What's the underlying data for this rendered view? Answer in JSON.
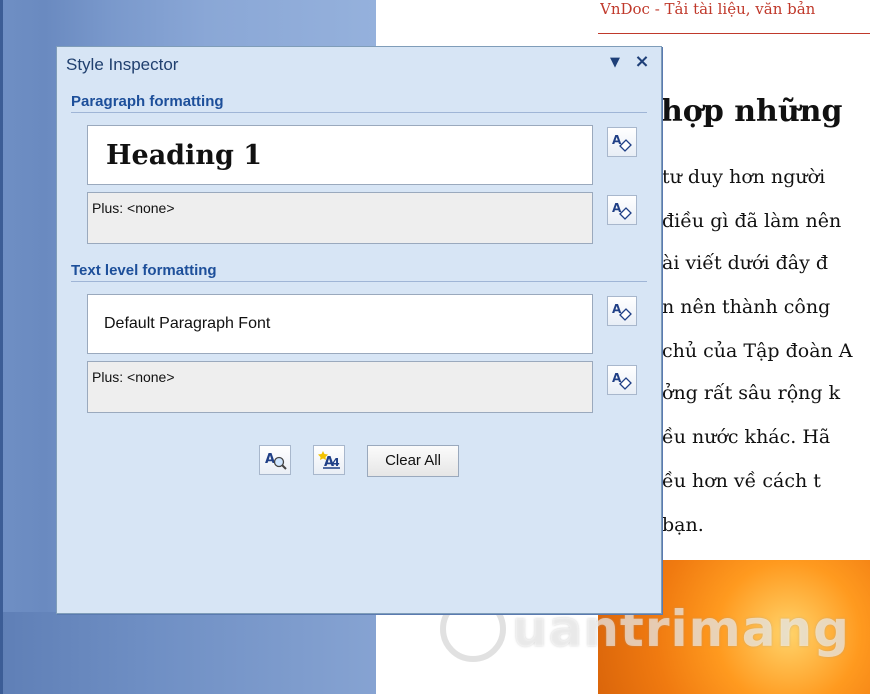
{
  "document": {
    "header": "VnDoc - Tải tài liệu, văn bản",
    "title": "hợp những",
    "lines": [
      "tư duy hơn người",
      "điều gì đã làm nên",
      "ài viết dưới đây đ",
      "n nên thành công",
      "chủ của Tập đoàn A",
      "ởng rất sâu rộng k",
      "ều nước khác. Hã",
      "ều hơn về cách t",
      "bạn."
    ],
    "watermark": "uantrimang"
  },
  "panel": {
    "title": "Style Inspector",
    "paragraph_section": {
      "heading": "Paragraph formatting",
      "style_name": "Heading 1",
      "plus": "Plus: <none>"
    },
    "text_section": {
      "heading": "Text level formatting",
      "style_name": "Default Paragraph Font",
      "plus": "Plus: <none>"
    },
    "buttons": {
      "clear_all": "Clear All"
    }
  },
  "colors": {
    "panel_bg": "#d7e5f5",
    "section_heading": "#1d4f9a",
    "header_red": "#c0392b"
  }
}
